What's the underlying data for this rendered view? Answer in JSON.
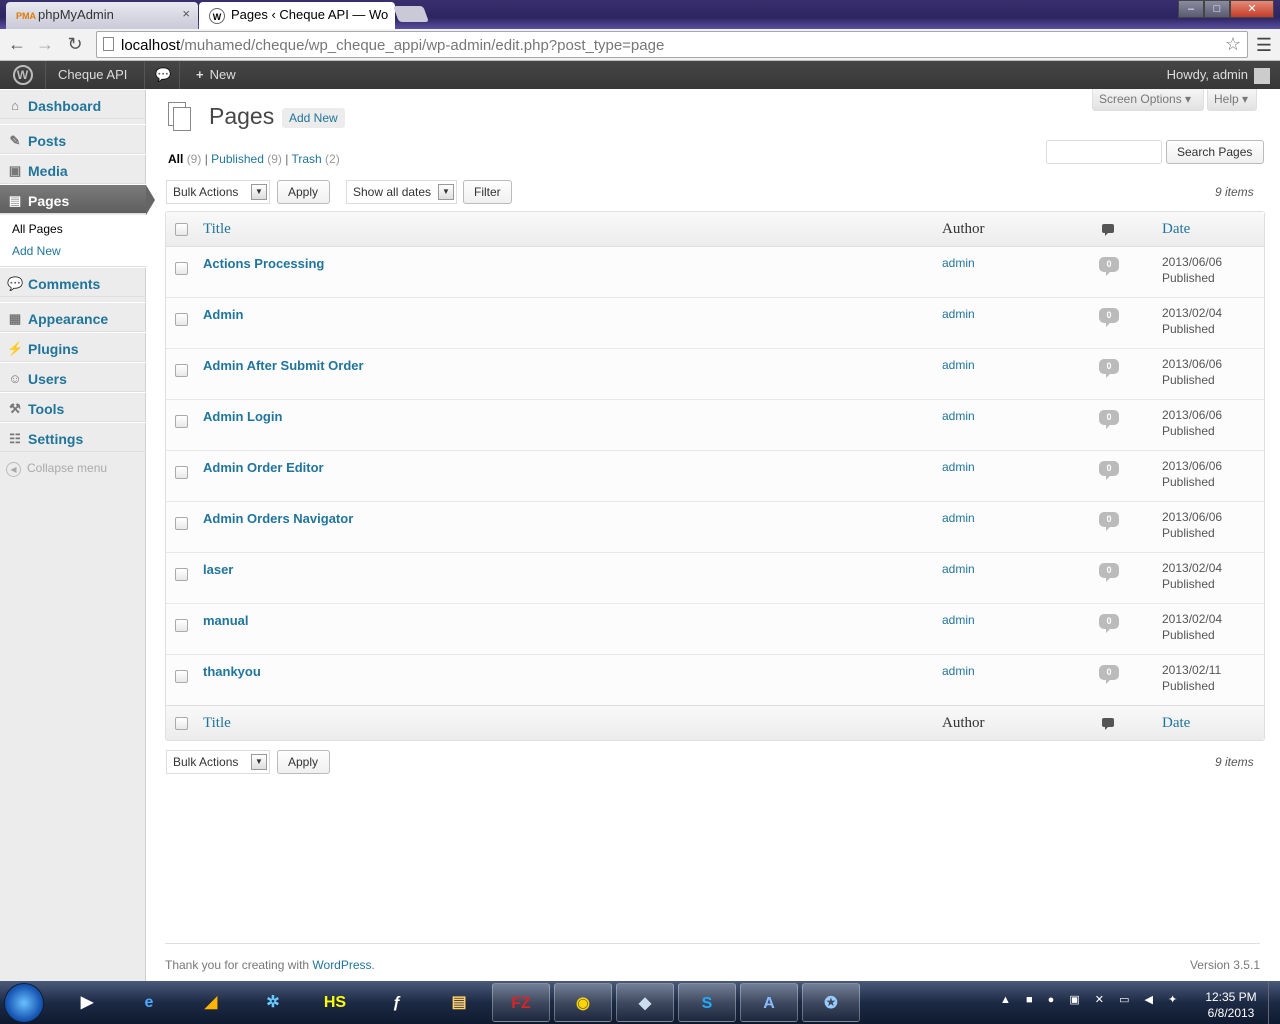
{
  "browser": {
    "tabs": [
      {
        "icon": "PMA",
        "label": "phpMyAdmin"
      },
      {
        "icon": "W",
        "label": "Pages ‹ Cheque API — Wo"
      }
    ],
    "url_host": "localhost",
    "url_path": "/muhamed/cheque/wp_cheque_appi/wp-admin/edit.php?post_type=page",
    "window_buttons": {
      "minimize": "–",
      "maximize": "□",
      "close": "✕"
    }
  },
  "adminbar": {
    "site_name": "Cheque API",
    "new_label": "New",
    "howdy": "Howdy, admin"
  },
  "sidebar": {
    "menu": {
      "dashboard": "Dashboard",
      "posts": "Posts",
      "media": "Media",
      "pages": "Pages",
      "comments": "Comments",
      "appearance": "Appearance",
      "plugins": "Plugins",
      "users": "Users",
      "tools": "Tools",
      "settings": "Settings"
    },
    "submenu": {
      "all_pages": "All Pages",
      "add_new": "Add New"
    },
    "collapse": "Collapse menu"
  },
  "header": {
    "screen_options": "Screen Options ▾",
    "help": "Help ▾",
    "title": "Pages",
    "add_new": "Add New"
  },
  "filters": {
    "all": "All",
    "all_count": "(9)",
    "published": "Published",
    "published_count": "(9)",
    "trash": "Trash",
    "trash_count": "(2)",
    "search_button": "Search Pages",
    "bulk_actions": "Bulk Actions",
    "apply": "Apply",
    "dates": "Show all dates",
    "filter": "Filter",
    "items_count": "9 items"
  },
  "table": {
    "columns": {
      "title": "Title",
      "author": "Author",
      "date": "Date"
    },
    "rows": [
      {
        "title": "Actions Processing",
        "author": "admin",
        "comments": "0",
        "date": "2013/06/06",
        "status": "Published"
      },
      {
        "title": "Admin",
        "author": "admin",
        "comments": "0",
        "date": "2013/02/04",
        "status": "Published"
      },
      {
        "title": "Admin After Submit Order",
        "author": "admin",
        "comments": "0",
        "date": "2013/06/06",
        "status": "Published"
      },
      {
        "title": "Admin Login",
        "author": "admin",
        "comments": "0",
        "date": "2013/06/06",
        "status": "Published"
      },
      {
        "title": "Admin Order Editor",
        "author": "admin",
        "comments": "0",
        "date": "2013/06/06",
        "status": "Published"
      },
      {
        "title": "Admin Orders Navigator",
        "author": "admin",
        "comments": "0",
        "date": "2013/06/06",
        "status": "Published"
      },
      {
        "title": "laser",
        "author": "admin",
        "comments": "0",
        "date": "2013/02/04",
        "status": "Published"
      },
      {
        "title": "manual",
        "author": "admin",
        "comments": "0",
        "date": "2013/02/04",
        "status": "Published"
      },
      {
        "title": "thankyou",
        "author": "admin",
        "comments": "0",
        "date": "2013/02/11",
        "status": "Published"
      }
    ]
  },
  "footer": {
    "thanks": "Thank you for creating with ",
    "wp_link": "WordPress",
    "period": ".",
    "version": "Version 3.5.1"
  },
  "taskbar": {
    "time": "12:35 PM",
    "date": "6/8/2013"
  }
}
